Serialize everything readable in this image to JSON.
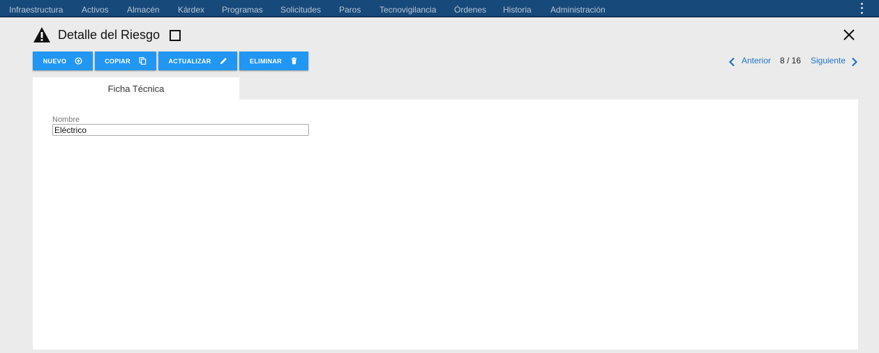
{
  "nav": {
    "items": [
      "Infraestructura",
      "Activos",
      "Almacén",
      "Kárdex",
      "Programas",
      "Solicitudes",
      "Paros",
      "Tecnovigilancia",
      "Órdenes",
      "Historia",
      "Administración"
    ]
  },
  "header": {
    "title": "Detalle del Riesgo"
  },
  "toolbar": {
    "nuevo_label": "NUEVO",
    "copiar_label": "COPIAR",
    "actualizar_label": "ACTUALIZAR",
    "eliminar_label": "ELIMINAR"
  },
  "pager": {
    "prev_label": "Anterior",
    "count": "8 / 16",
    "next_label": "Siguiente"
  },
  "tabs": [
    {
      "label": "Ficha Técnica"
    }
  ],
  "form": {
    "nombre_label": "Nombre",
    "nombre_value": "Eléctrico"
  },
  "colors": {
    "nav_bg": "#17497a",
    "accent": "#2196f3",
    "link": "#1e73c8",
    "page_bg": "#ebebeb"
  },
  "icons": {
    "title": "warning-icon",
    "close": "close-icon",
    "nuevo": "add-circle-icon",
    "copiar": "copy-icon",
    "actualizar": "pencil-icon",
    "eliminar": "trash-icon",
    "prev": "chevron-left-icon",
    "next": "chevron-right-icon",
    "menu": "kebab-menu-icon"
  }
}
